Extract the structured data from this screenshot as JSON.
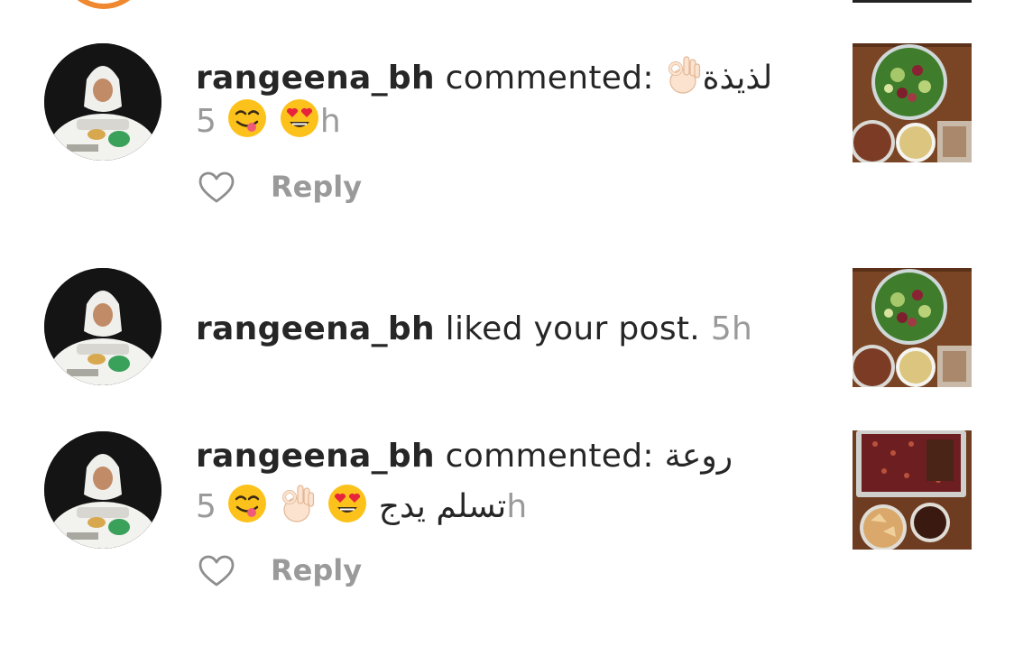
{
  "notifications": [
    {
      "username": "rangeena_bh",
      "action": "commented:",
      "comment_text": "لذيذة",
      "time_prefix": "5",
      "time_suffix": "h",
      "reply_label": "Reply",
      "icons": [
        "ok-hand-emoji",
        "yum-face-emoji",
        "heart-eyes-emoji",
        "heart-icon"
      ]
    },
    {
      "username": "rangeena_bh",
      "action": "liked your post.",
      "time": "5h"
    },
    {
      "username": "rangeena_bh",
      "action": "commented:",
      "comment_text": "روعة",
      "comment_text_2": "تسلم يدج",
      "time_prefix": "5",
      "time_suffix": "h",
      "reply_label": "Reply",
      "icons": [
        "yum-face-emoji",
        "ok-hand-emoji",
        "heart-eyes-emoji",
        "heart-icon"
      ]
    }
  ],
  "colors": {
    "text": "#262626",
    "secondary": "#9a9a9a",
    "story_ring": "#f0882f"
  }
}
